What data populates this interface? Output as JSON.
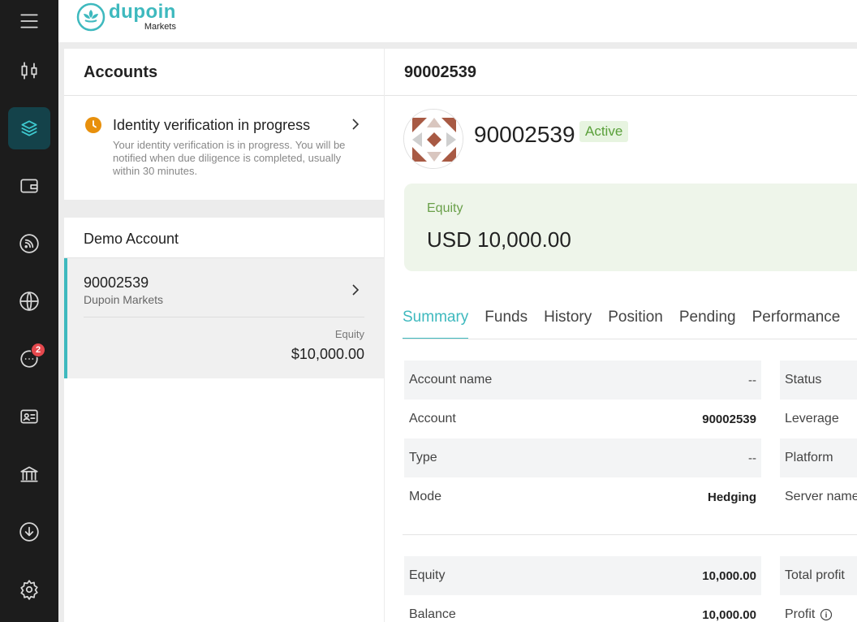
{
  "sidebar": {
    "items": [
      {
        "name": "menu-icon"
      },
      {
        "name": "chart-candles-icon"
      },
      {
        "name": "accounts-layers-icon",
        "active": true
      },
      {
        "name": "wallet-icon"
      },
      {
        "name": "feed-icon"
      },
      {
        "name": "globe-icon"
      },
      {
        "name": "chat-icon",
        "badge": "2"
      },
      {
        "name": "id-card-icon"
      },
      {
        "name": "bank-icon"
      },
      {
        "name": "download-icon"
      },
      {
        "name": "settings-icon"
      }
    ],
    "accent": "#3ecad0"
  },
  "brand": {
    "name": "dupoin",
    "sub": "Markets",
    "color": "#3eb9be"
  },
  "accounts_panel": {
    "title": "Accounts",
    "verification": {
      "title": "Identity verification in progress",
      "description": "Your identity verification is in progress. You will be notified when due diligence is completed, usually within 30 minutes."
    },
    "demo_section": "Demo Account",
    "card": {
      "number": "90002539",
      "broker": "Dupoin Markets",
      "equity_label": "Equity",
      "equity_value": "$10,000.00"
    }
  },
  "detail": {
    "title": "90002539",
    "account_number": "90002539",
    "status": "Active",
    "equity_label": "Equity",
    "equity_value": "USD 10,000.00",
    "tabs": [
      "Summary",
      "Funds",
      "History",
      "Position",
      "Pending",
      "Performance"
    ],
    "info_left": [
      {
        "label": "Account name",
        "value": "--"
      },
      {
        "label": "Account",
        "value": "90002539"
      },
      {
        "label": "Type",
        "value": "--"
      },
      {
        "label": "Mode",
        "value": "Hedging"
      }
    ],
    "info_right": [
      "Status",
      "Leverage",
      "Platform",
      "Server name"
    ],
    "fin_left": [
      {
        "label": "Equity",
        "value": "10,000.00"
      },
      {
        "label": "Balance",
        "value": "10,000.00"
      }
    ],
    "fin_right": [
      "Total profit",
      "Profit"
    ]
  }
}
